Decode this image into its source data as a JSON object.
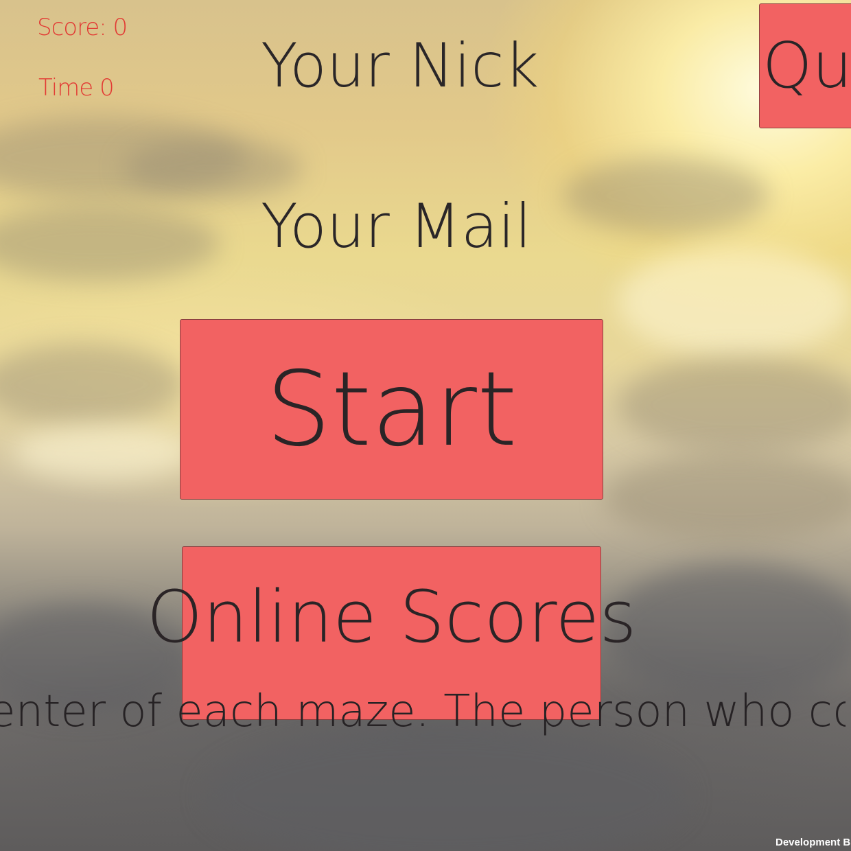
{
  "hud": {
    "score_text": "Score: 0",
    "time_text": "Time 0"
  },
  "form": {
    "nick_label": "Your Nick",
    "mail_label": "Your Mail"
  },
  "buttons": {
    "quit_label": "Qu",
    "start_label": "Start",
    "online_scores_label": "Online Scores"
  },
  "instructions_text": "ch center of each maze. The person who collects the",
  "footer": {
    "build_label": "Development Build"
  },
  "colors": {
    "button_fill": "#f26262",
    "hud_text": "#e23a34",
    "label_text": "#2a2628"
  }
}
